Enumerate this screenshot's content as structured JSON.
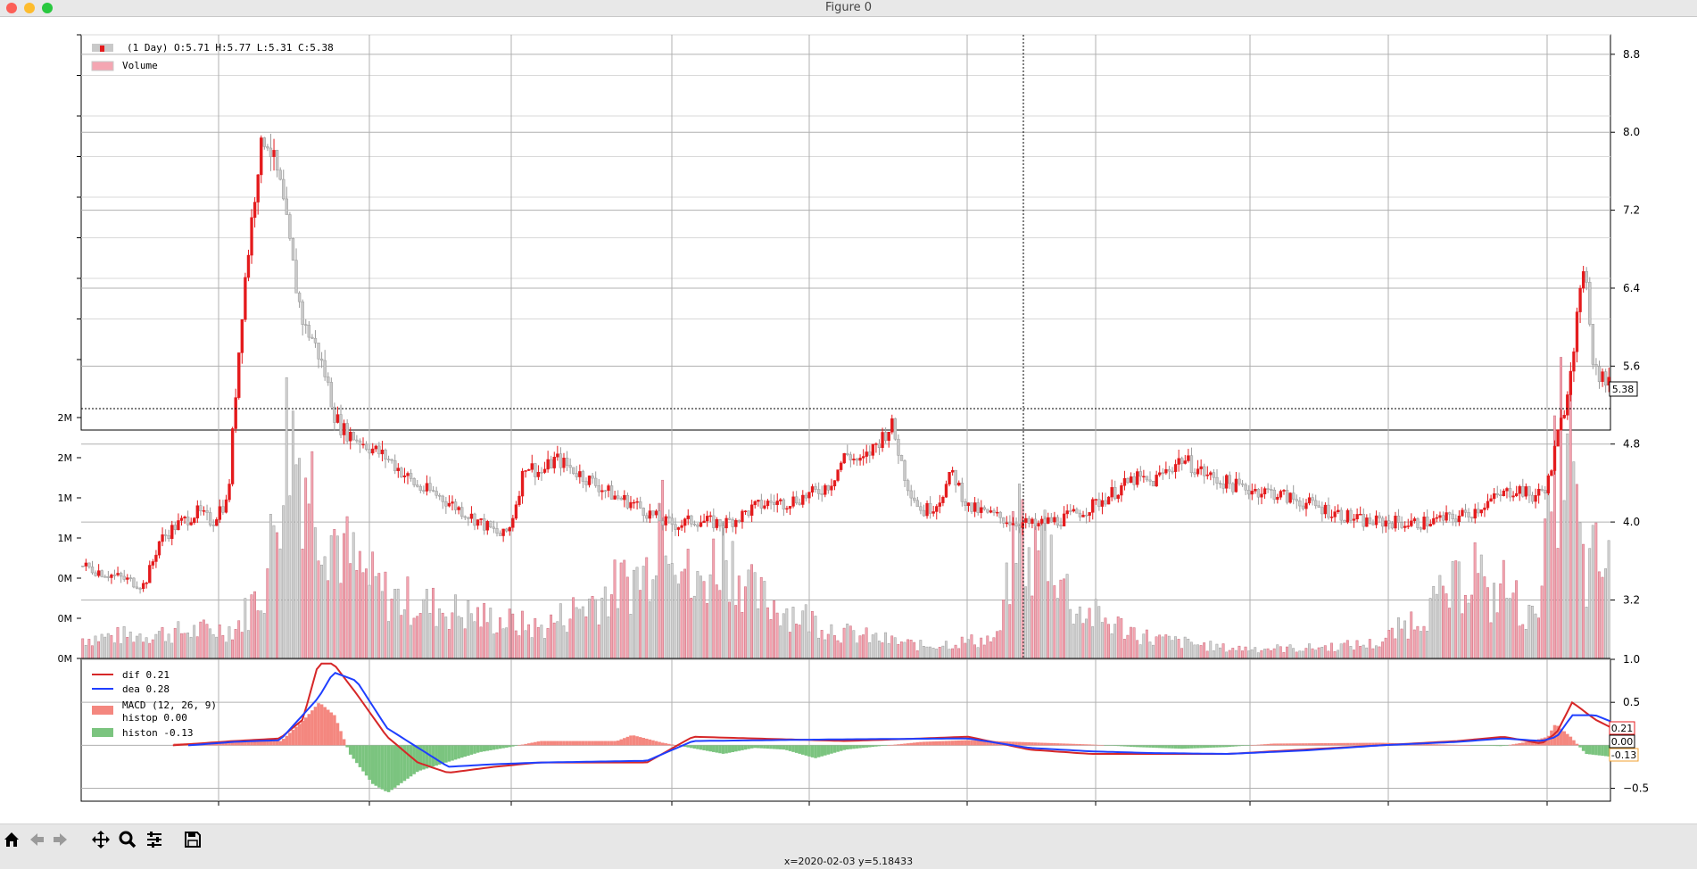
{
  "window": {
    "title": "Figure 0"
  },
  "status": {
    "coordinates": "x=2020-02-03 y=5.18433"
  },
  "toolbar": {
    "buttons": [
      "home-icon",
      "back-icon",
      "forward-icon",
      "pan-icon",
      "zoom-icon",
      "configure-icon",
      "save-icon"
    ]
  },
  "colors": {
    "up": "#e41a1c",
    "down": "#c9c9c9",
    "vol_up": "#f4a6b2",
    "dif": "#d62728",
    "dea": "#1f3fff",
    "hist_pos": "#f4877f",
    "hist_neg": "#7bc47f"
  },
  "chart_data": {
    "type": "candlestick",
    "legend": {
      "price": "(1 Day) O:5.71 H:5.77 L:5.31 C:5.38",
      "volume": "Volume",
      "dif": "dif 0.21",
      "dea": "dea 0.28",
      "macd": "MACD (12, 26, 9)",
      "histop": "histop 0.00",
      "histon": "histon -0.13"
    },
    "price_axis": {
      "ticks": [
        3.2,
        4.0,
        4.8,
        5.6,
        6.4,
        7.2,
        8.0,
        8.8
      ],
      "labels": [
        "3.2",
        "4.0",
        "4.8",
        "5.6",
        "6.4",
        "7.2",
        "8.0",
        "8.8"
      ],
      "ylim": [
        2.6,
        9.0
      ],
      "position": "right"
    },
    "volume_axis": {
      "labels": [
        "0M",
        "0M",
        "0M",
        "1M",
        "1M",
        "2M",
        "2M"
      ],
      "position": "left"
    },
    "macd_axis": {
      "ticks": [
        1.0,
        0.5,
        -0.5
      ],
      "labels": [
        "1.0",
        "0.5",
        "−0.5"
      ],
      "ylim": [
        -0.65,
        1.0
      ],
      "position": "right"
    },
    "last": {
      "open": 5.71,
      "high": 5.77,
      "low": 5.31,
      "close": 5.38
    },
    "markers": {
      "close_label": "5.38",
      "dif_label": "0.21",
      "histop_label": "0.00",
      "histon_label": "-0.13"
    },
    "crosshair": {
      "x": "2020-02-03",
      "y": 5.18433
    },
    "price_path": {
      "x": [
        0,
        0.04,
        0.045,
        0.05,
        0.06,
        0.07,
        0.075,
        0.08,
        0.085,
        0.09,
        0.095,
        0.1,
        0.105,
        0.11,
        0.115,
        0.12,
        0.13,
        0.135,
        0.14,
        0.145,
        0.15,
        0.155,
        0.16,
        0.165,
        0.17,
        0.175,
        0.18,
        0.19,
        0.2,
        0.21,
        0.22,
        0.23,
        0.24,
        0.25,
        0.26,
        0.27,
        0.275,
        0.28,
        0.29,
        0.3,
        0.31,
        0.33,
        0.35,
        0.36,
        0.37,
        0.38,
        0.39,
        0.4,
        0.41,
        0.42,
        0.43,
        0.44,
        0.45,
        0.46,
        0.47,
        0.48,
        0.49,
        0.5,
        0.51,
        0.52,
        0.53,
        0.54,
        0.55,
        0.56,
        0.57,
        0.58,
        0.59,
        0.6,
        0.61,
        0.62,
        0.625,
        0.63,
        0.64,
        0.65,
        0.66,
        0.67,
        0.68,
        0.69,
        0.7,
        0.72,
        0.74,
        0.76,
        0.78,
        0.8,
        0.82,
        0.84,
        0.86,
        0.87,
        0.88,
        0.9,
        0.91,
        0.92,
        0.94,
        0.95,
        0.955,
        0.96,
        0.963,
        0.966,
        0.97,
        0.975,
        0.98,
        0.985,
        0.99,
        0.995,
        1.0
      ],
      "price": [
        3.55,
        3.35,
        3.55,
        3.8,
        3.95,
        4.05,
        4.1,
        4.05,
        4.0,
        4.15,
        4.2,
        5.3,
        6.3,
        7.0,
        7.7,
        8.0,
        7.4,
        6.9,
        6.4,
        6.0,
        5.9,
        5.7,
        5.45,
        5.1,
        4.95,
        4.9,
        4.85,
        4.75,
        4.65,
        4.5,
        4.35,
        4.3,
        4.2,
        4.1,
        4.0,
        3.9,
        3.85,
        3.95,
        4.6,
        4.5,
        4.65,
        4.45,
        4.25,
        4.2,
        4.1,
        4.0,
        3.97,
        4.02,
        4.0,
        3.98,
        4.05,
        4.15,
        4.2,
        4.2,
        4.25,
        4.3,
        4.4,
        4.7,
        4.6,
        4.8,
        5.0,
        4.4,
        4.1,
        4.2,
        4.5,
        4.15,
        4.1,
        4.05,
        4.0,
        3.98,
        3.95,
        4.0,
        4.02,
        4.08,
        4.15,
        4.25,
        4.35,
        4.45,
        4.4,
        4.65,
        4.45,
        4.35,
        4.3,
        4.2,
        4.1,
        4.0,
        4.0,
        3.98,
        4.0,
        4.05,
        4.1,
        4.2,
        4.35,
        4.25,
        4.3,
        4.4,
        4.6,
        4.85,
        5.1,
        5.6,
        6.2,
        6.6,
        5.6,
        5.5,
        5.4
      ]
    },
    "volume_path": {
      "x": [
        0,
        0.1,
        0.12,
        0.13,
        0.135,
        0.14,
        0.15,
        0.16,
        0.18,
        0.2,
        0.25,
        0.3,
        0.37,
        0.38,
        0.4,
        0.42,
        0.44,
        0.5,
        0.55,
        0.6,
        0.615,
        0.62,
        0.63,
        0.65,
        0.7,
        0.75,
        0.8,
        0.85,
        0.9,
        0.915,
        0.92,
        0.93,
        0.95,
        0.96,
        0.965,
        0.97,
        0.975,
        0.98,
        0.985,
        0.99,
        1.0
      ],
      "volume": [
        0.08,
        0.12,
        0.3,
        0.75,
        0.95,
        0.85,
        0.7,
        0.55,
        0.35,
        0.25,
        0.18,
        0.12,
        0.35,
        0.7,
        0.25,
        0.45,
        0.25,
        0.1,
        0.05,
        0.08,
        0.6,
        0.35,
        0.5,
        0.2,
        0.08,
        0.04,
        0.04,
        0.06,
        0.28,
        0.4,
        0.2,
        0.3,
        0.15,
        0.5,
        0.7,
        0.95,
        0.85,
        0.5,
        0.3,
        0.4,
        0.35
      ]
    },
    "dif": {
      "x": [
        0.06,
        0.1,
        0.13,
        0.145,
        0.155,
        0.165,
        0.18,
        0.2,
        0.22,
        0.24,
        0.27,
        0.3,
        0.37,
        0.4,
        0.5,
        0.55,
        0.58,
        0.62,
        0.66,
        0.7,
        0.75,
        0.8,
        0.85,
        0.9,
        0.93,
        0.955,
        0.965,
        0.975,
        0.99,
        1.0
      ],
      "values": [
        0.0,
        0.05,
        0.08,
        0.3,
        0.95,
        0.95,
        0.6,
        0.1,
        -0.2,
        -0.32,
        -0.25,
        -0.2,
        -0.2,
        0.1,
        0.05,
        0.08,
        0.1,
        -0.05,
        -0.1,
        -0.1,
        -0.1,
        -0.05,
        0.0,
        0.05,
        0.1,
        0.02,
        0.15,
        0.5,
        0.3,
        0.21
      ]
    },
    "dea": {
      "x": [
        0.07,
        0.1,
        0.13,
        0.155,
        0.165,
        0.18,
        0.2,
        0.24,
        0.27,
        0.3,
        0.37,
        0.4,
        0.5,
        0.58,
        0.62,
        0.66,
        0.7,
        0.75,
        0.8,
        0.85,
        0.9,
        0.93,
        0.955,
        0.965,
        0.975,
        0.99,
        1.0
      ],
      "values": [
        0.0,
        0.04,
        0.06,
        0.55,
        0.85,
        0.75,
        0.2,
        -0.25,
        -0.22,
        -0.2,
        -0.18,
        0.05,
        0.07,
        0.08,
        -0.03,
        -0.07,
        -0.09,
        -0.1,
        -0.06,
        0.0,
        0.04,
        0.08,
        0.05,
        0.1,
        0.35,
        0.35,
        0.28
      ]
    },
    "hist": {
      "x": [
        0.06,
        0.12,
        0.13,
        0.145,
        0.155,
        0.165,
        0.175,
        0.19,
        0.2,
        0.22,
        0.26,
        0.28,
        0.3,
        0.35,
        0.36,
        0.38,
        0.42,
        0.44,
        0.46,
        0.48,
        0.5,
        0.55,
        0.58,
        0.66,
        0.69,
        0.72,
        0.75,
        0.78,
        0.85,
        0.93,
        0.95,
        0.96,
        0.965,
        0.975,
        0.985,
        1.0
      ],
      "values": [
        0.02,
        0.05,
        0.05,
        0.3,
        0.5,
        0.35,
        -0.1,
        -0.45,
        -0.55,
        -0.3,
        -0.08,
        -0.02,
        0.05,
        0.05,
        0.12,
        0.03,
        -0.1,
        -0.03,
        -0.05,
        -0.15,
        -0.05,
        0.04,
        0.06,
        0.01,
        -0.02,
        -0.04,
        -0.02,
        0.02,
        0.03,
        -0.01,
        0.05,
        0.1,
        0.25,
        0.1,
        -0.1,
        -0.13
      ]
    }
  }
}
